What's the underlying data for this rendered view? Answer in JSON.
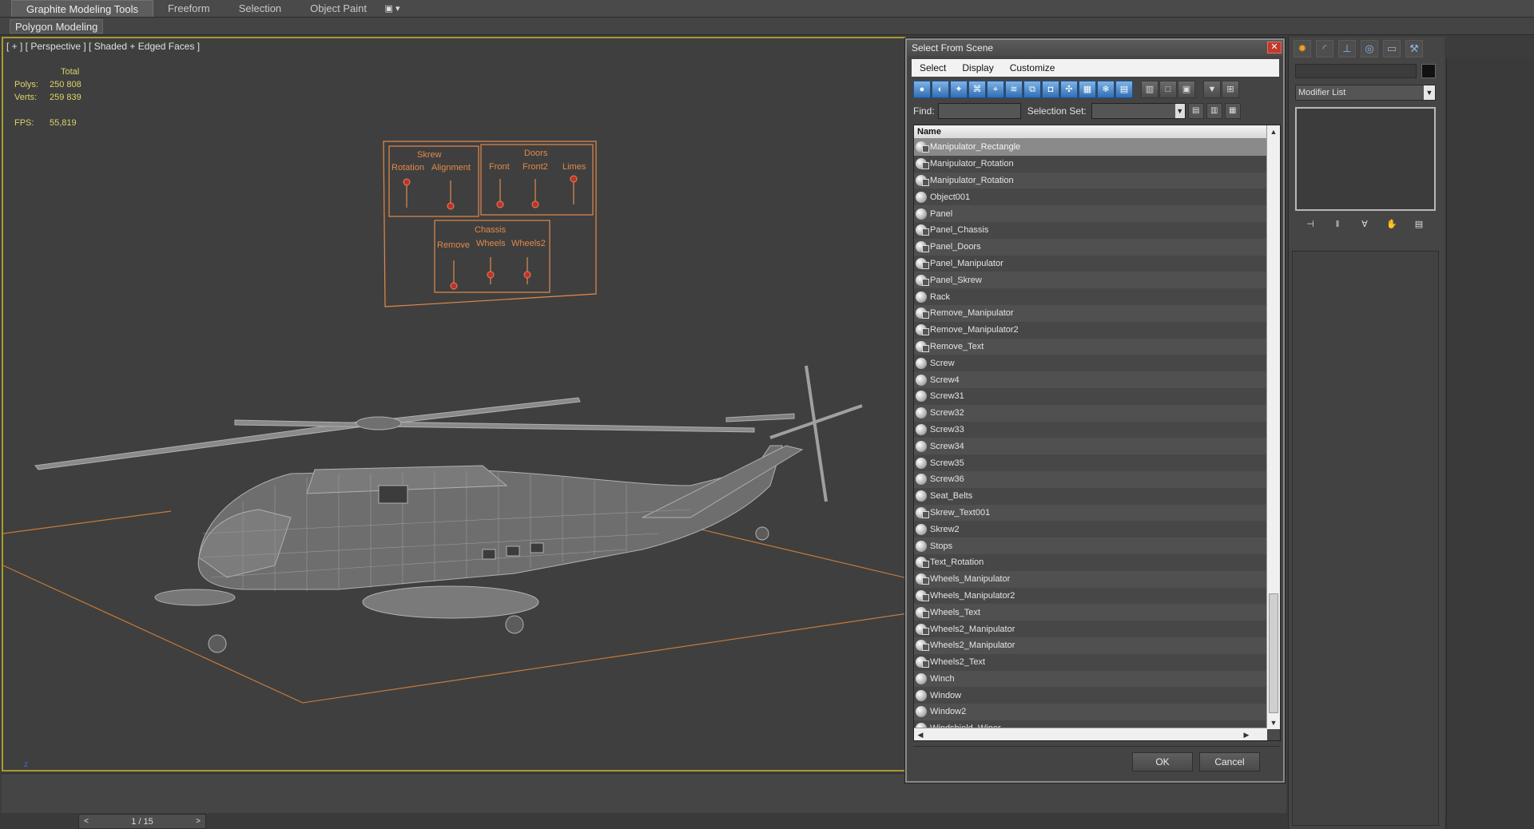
{
  "ribbon": {
    "tabs": [
      "Graphite Modeling Tools",
      "Freeform",
      "Selection",
      "Object Paint"
    ],
    "options_glyph": "▣ ▾",
    "panel_title": "Polygon Modeling"
  },
  "viewport": {
    "label": "[ + ] [ Perspective ] [ Shaded + Edged Faces ]",
    "stats": {
      "header": "Total",
      "polys_label": "Polys:",
      "polys_value": "250 808",
      "verts_label": "Verts:",
      "verts_value": "259 839",
      "fps_label": "FPS:",
      "fps_value": "55,819"
    },
    "control_panel": {
      "group1_title": "Skrew",
      "group1_labels": [
        "Rotation",
        "Alignment"
      ],
      "group2_title": "Doors",
      "group2_labels": [
        "Front",
        "Front2",
        "Limes"
      ],
      "group3_title": "Chassis",
      "group3_labels": [
        "Remove",
        "Wheels",
        "Wheels2"
      ]
    }
  },
  "timeline": {
    "value": "1 / 15",
    "prev": "<",
    "next": ">"
  },
  "dialog": {
    "title": "Select From Scene",
    "close": "✕",
    "menu": [
      "Select",
      "Display",
      "Customize"
    ],
    "find_label": "Find:",
    "selset_label": "Selection Set:",
    "column_header": "Name",
    "items": [
      "Manipulator_Rectangle",
      "Manipulator_Rotation",
      "Manipulator_Rotation",
      "Object001",
      "Panel",
      "Panel_Chassis",
      "Panel_Doors",
      "Panel_Manipulator",
      "Panel_Skrew",
      "Rack",
      "Remove_Manipulator",
      "Remove_Manipulator2",
      "Remove_Text",
      "Screw",
      "Screw4",
      "Screw31",
      "Screw32",
      "Screw33",
      "Screw34",
      "Screw35",
      "Screw36",
      "Seat_Belts",
      "Skrew_Text001",
      "Skrew2",
      "Stops",
      "Text_Rotation",
      "Wheels_Manipulator",
      "Wheels_Manipulator2",
      "Wheels_Text",
      "Wheels2_Manipulator",
      "Wheels2_Manipulator",
      "Wheels2_Text",
      "Winch",
      "Window",
      "Window2",
      "Windshield_Wiper"
    ],
    "ok": "OK",
    "cancel": "Cancel"
  },
  "command_panel": {
    "modifier_list": "Modifier List"
  },
  "colors": {
    "viewport_border": "#a89a2e",
    "stats_text": "#dcd46a",
    "control_orange": "#e08a4a",
    "ground_line": "#c77a3a"
  }
}
